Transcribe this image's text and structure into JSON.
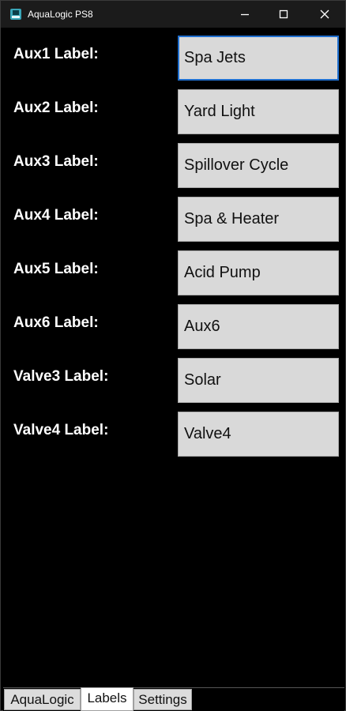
{
  "window": {
    "title": "AquaLogic PS8",
    "icon": "app-icon",
    "minimize_icon": "minimize-icon",
    "maximize_icon": "maximize-icon",
    "close_icon": "close-icon"
  },
  "labels_form": {
    "rows": [
      {
        "label": "Aux1 Label:",
        "value": "Spa Jets",
        "focused": true
      },
      {
        "label": "Aux2 Label:",
        "value": "Yard Light"
      },
      {
        "label": "Aux3 Label:",
        "value": "Spillover Cycle"
      },
      {
        "label": "Aux4 Label:",
        "value": "Spa & Heater"
      },
      {
        "label": "Aux5 Label:",
        "value": "Acid Pump"
      },
      {
        "label": "Aux6 Label:",
        "value": "Aux6"
      },
      {
        "label": "Valve3 Label:",
        "value": "Solar"
      },
      {
        "label": "Valve4 Label:",
        "value": "Valve4"
      }
    ]
  },
  "tabs": [
    {
      "label": "AquaLogic",
      "selected": false
    },
    {
      "label": "Labels",
      "selected": true
    },
    {
      "label": "Settings",
      "selected": false
    }
  ],
  "colors": {
    "background": "#000000",
    "titlebar": "#1b1b1b",
    "input_background": "#d9d9d9",
    "focus_border": "#1f6fcf",
    "label_text": "#ffffff"
  }
}
